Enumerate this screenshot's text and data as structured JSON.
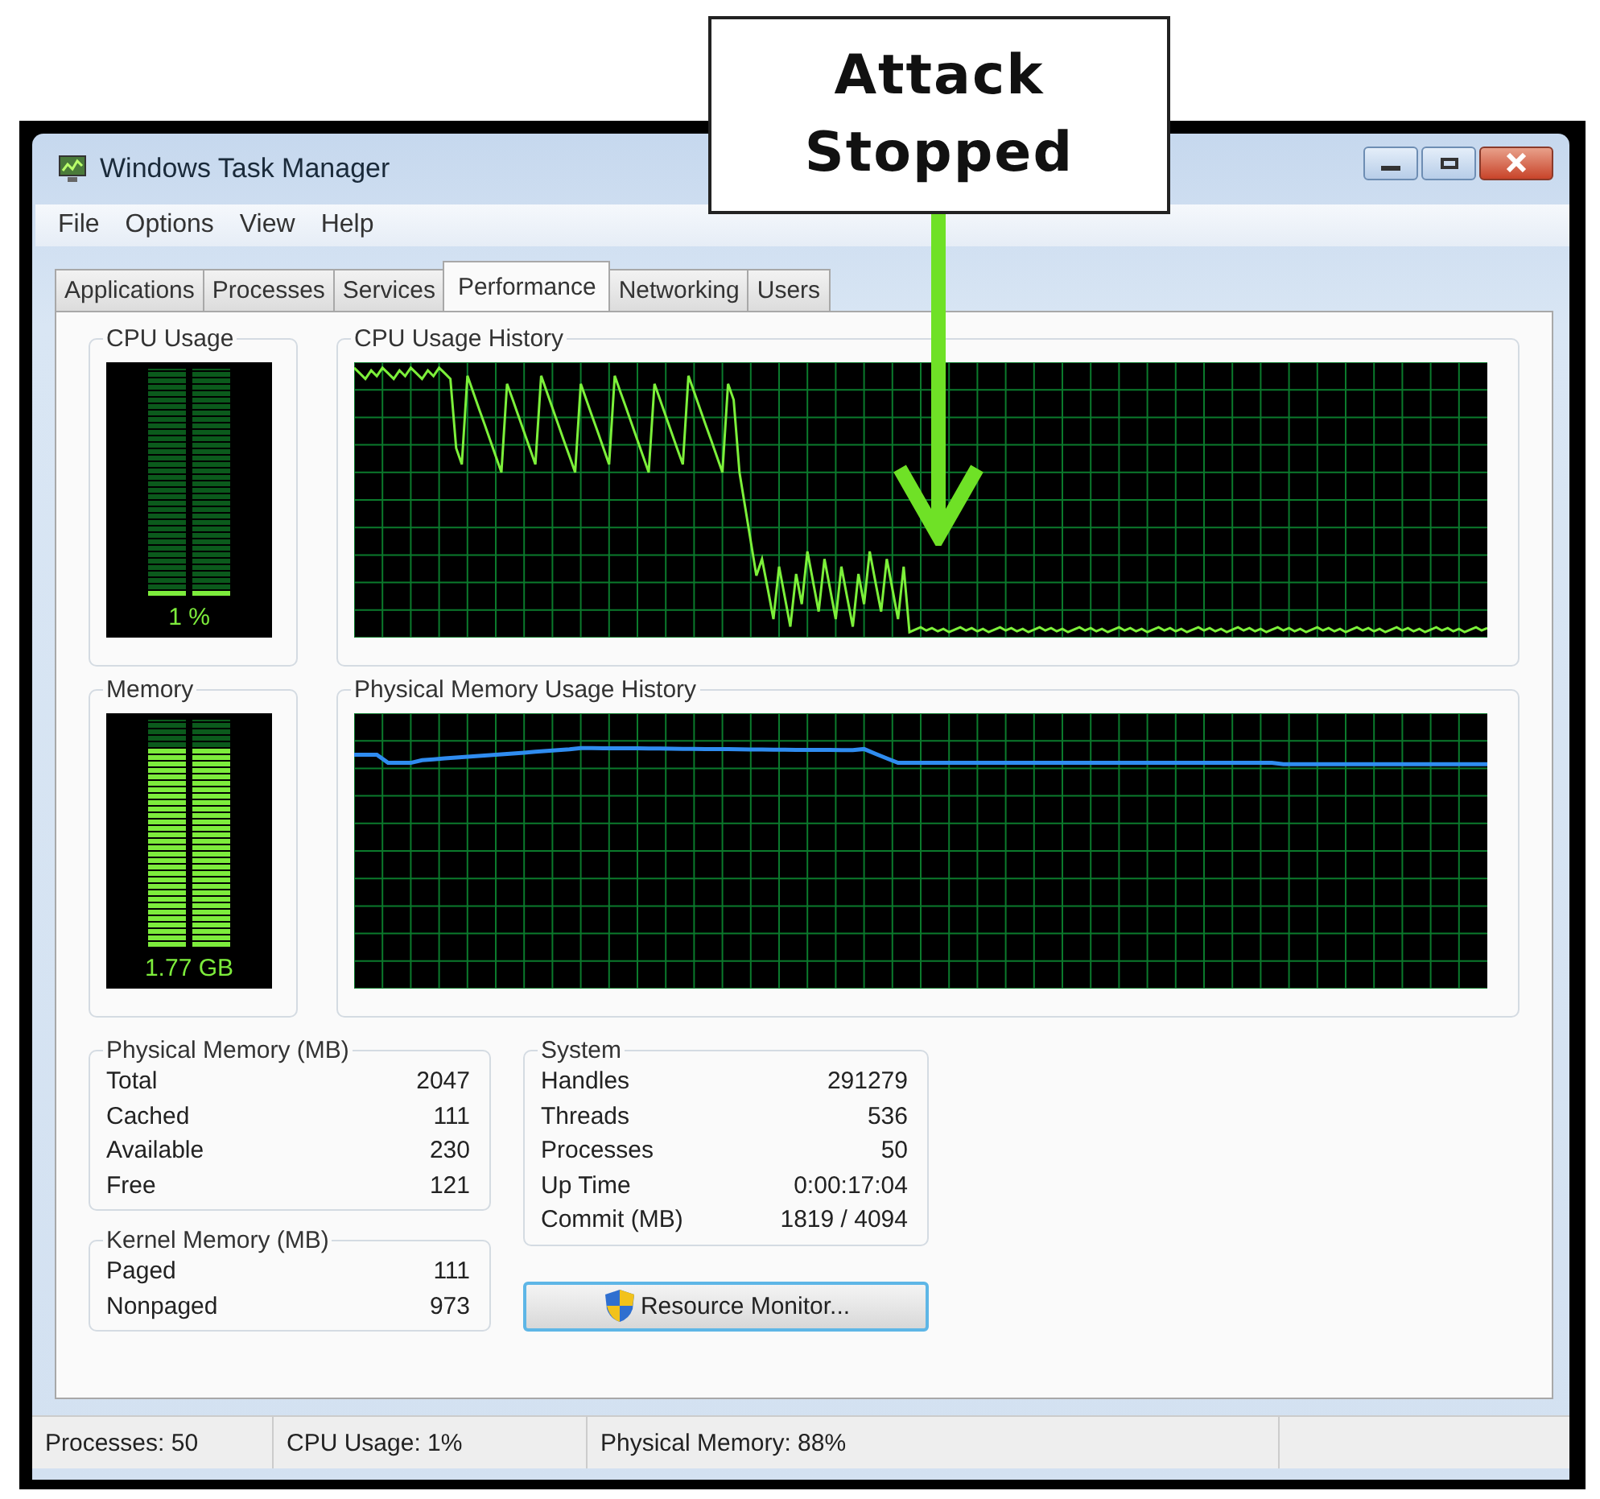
{
  "window": {
    "title": "Windows Task Manager"
  },
  "menu": [
    "File",
    "Options",
    "View",
    "Help"
  ],
  "tabs": [
    {
      "label": "Applications",
      "selected": false
    },
    {
      "label": "Processes",
      "selected": false
    },
    {
      "label": "Services",
      "selected": false
    },
    {
      "label": "Performance",
      "selected": true
    },
    {
      "label": "Networking",
      "selected": false
    },
    {
      "label": "Users",
      "selected": false
    }
  ],
  "cpu_usage": {
    "title": "CPU Usage",
    "level": 0.01,
    "reading": "1 %"
  },
  "cpu_history": {
    "title": "CPU Usage History"
  },
  "memory": {
    "title": "Memory",
    "level": 0.88,
    "reading": "1.77 GB"
  },
  "memory_history": {
    "title": "Physical Memory Usage History"
  },
  "physical_memory": {
    "title": "Physical Memory (MB)",
    "rows": [
      {
        "label": "Total",
        "value": "2047"
      },
      {
        "label": "Cached",
        "value": "111"
      },
      {
        "label": "Available",
        "value": "230"
      },
      {
        "label": "Free",
        "value": "121"
      }
    ]
  },
  "kernel_memory": {
    "title": "Kernel Memory (MB)",
    "rows": [
      {
        "label": "Paged",
        "value": "111"
      },
      {
        "label": "Nonpaged",
        "value": "973"
      }
    ]
  },
  "system": {
    "title": "System",
    "rows": [
      {
        "label": "Handles",
        "value": "291279"
      },
      {
        "label": "Threads",
        "value": "536"
      },
      {
        "label": "Processes",
        "value": "50"
      },
      {
        "label": "Up Time",
        "value": "0:00:17:04"
      },
      {
        "label": "Commit (MB)",
        "value": "1819 / 4094"
      }
    ]
  },
  "resource_monitor_button": {
    "label": "Resource Monitor..."
  },
  "status_bar": [
    "Processes: 50",
    "CPU Usage: 1%",
    "Physical Memory: 88%"
  ],
  "annotation": {
    "lines": [
      "Attack",
      "Stopped"
    ]
  }
}
